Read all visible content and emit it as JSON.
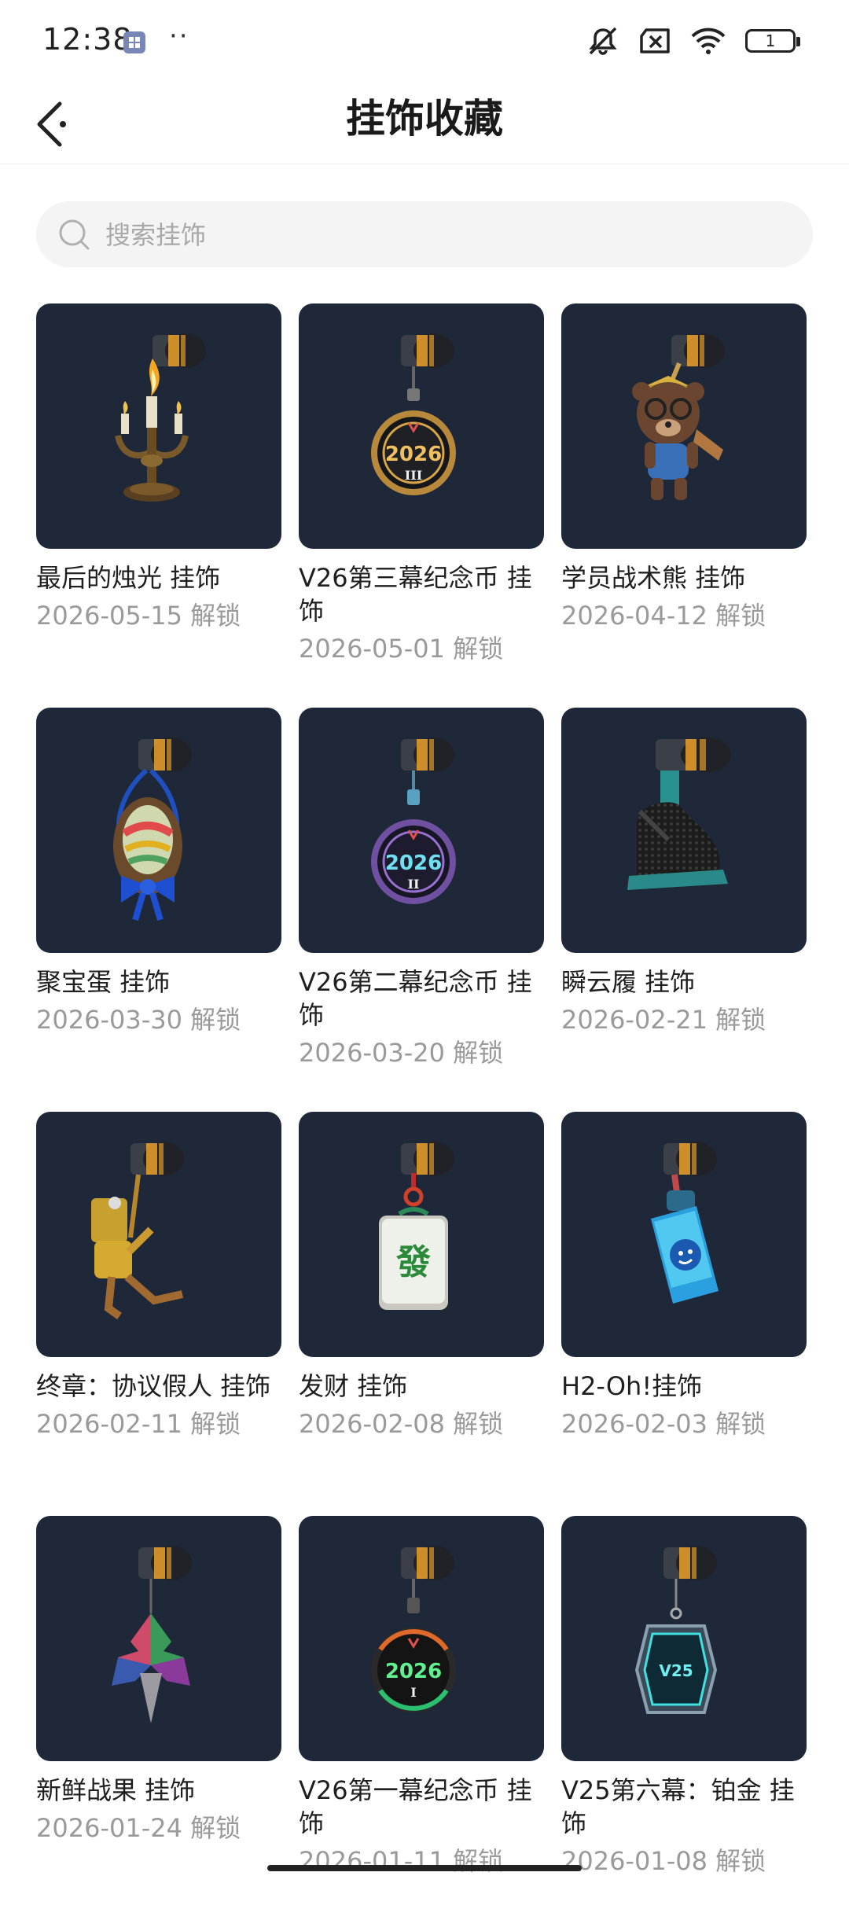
{
  "status_bar": {
    "time": "12:38",
    "more": "··",
    "battery_level": "1",
    "icons": [
      "app-notification-icon",
      "mute-icon",
      "no-sim-icon",
      "wifi-icon",
      "battery-icon"
    ]
  },
  "header": {
    "title": "挂饰收藏",
    "back_icon": "chevron-left-icon"
  },
  "search": {
    "placeholder": "搜索挂饰",
    "value": ""
  },
  "colors": {
    "card_background": "#1e2838",
    "date_text": "#9a9a9a",
    "search_background": "#f4f4f4"
  },
  "items": [
    {
      "name": "最后的烛光 挂饰",
      "date": "2026-05-15 解锁",
      "art": "candelabra"
    },
    {
      "name": "V26第三幕纪念币 挂饰",
      "date": "2026-05-01 解锁",
      "art": "coin-iii"
    },
    {
      "name": "学员战术熊 挂饰",
      "date": "2026-04-12 解锁",
      "art": "bear"
    },
    {
      "name": "聚宝蛋 挂饰",
      "date": "2026-03-30 解锁",
      "art": "egg"
    },
    {
      "name": "V26第二幕纪念币 挂饰",
      "date": "2026-03-20 解锁",
      "art": "coin-ii"
    },
    {
      "name": "瞬云履 挂饰",
      "date": "2026-02-21 解锁",
      "art": "shoe"
    },
    {
      "name": "终章：协议假人 挂饰",
      "date": "2026-02-11 解锁",
      "art": "dummy"
    },
    {
      "name": "发财 挂饰",
      "date": "2026-02-08 解锁",
      "art": "mahjong"
    },
    {
      "name": "H2-Oh!挂饰",
      "date": "2026-02-03 解锁",
      "art": "bottle"
    },
    {
      "name": "新鲜战果 挂饰",
      "date": "2026-01-24 解锁",
      "art": "leaf"
    },
    {
      "name": "V26第一幕纪念币 挂饰",
      "date": "2026-01-11 解锁",
      "art": "coin-i"
    },
    {
      "name": "V25第六幕：铂金 挂饰",
      "date": "2026-01-08 解锁",
      "art": "platinum-tag"
    }
  ],
  "coin_text": {
    "year": "2026",
    "act_iii": "III",
    "act_ii": "II",
    "act_i": "I",
    "v25": "V25",
    "mahjong": "發"
  }
}
